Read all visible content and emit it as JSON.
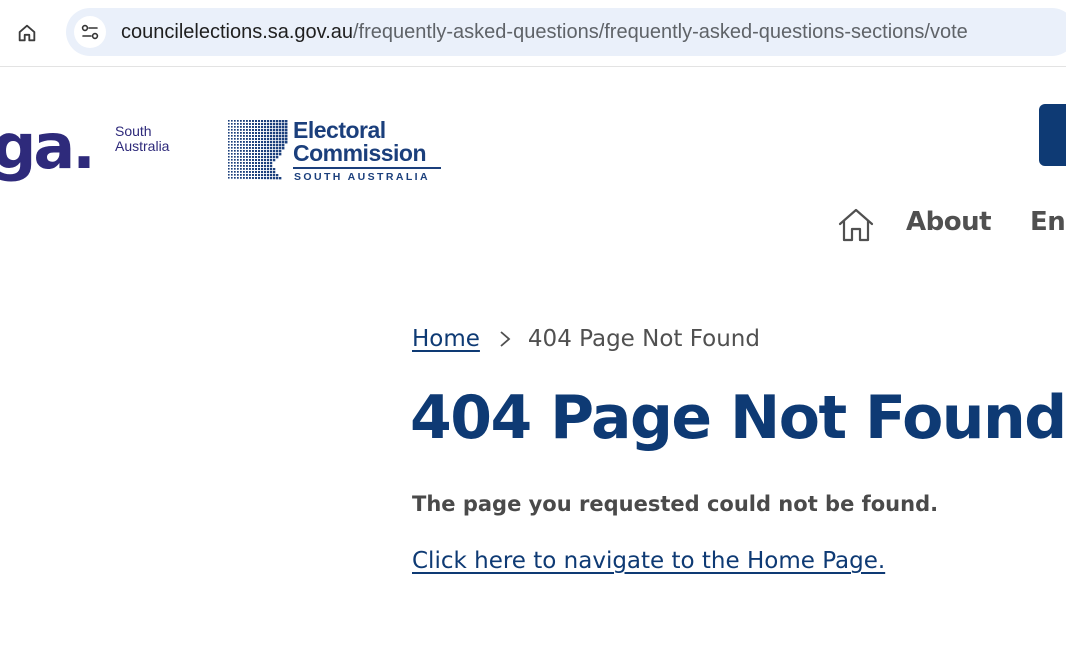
{
  "browser": {
    "url_domain": "councilelections.sa.gov.au",
    "url_path": "/frequently-asked-questions/frequently-asked-questions-sections/vote",
    "home_icon": "home-icon",
    "site_info_icon": "tune-icon"
  },
  "header": {
    "lga_logo": {
      "text": "ga.",
      "region_line1": "South",
      "region_line2": "Australia"
    },
    "ecsa_logo": {
      "line1": "Electoral",
      "line2": "Commission",
      "sub": "SOUTH AUSTRALIA"
    },
    "nav": {
      "home_icon": "home-icon",
      "items": [
        {
          "label": "About"
        },
        {
          "label": "Enr"
        }
      ]
    }
  },
  "breadcrumb": {
    "home_label": "Home",
    "current_label": "404 Page Not Found"
  },
  "main": {
    "title": "404 Page Not Found",
    "message": "The page you requested could not be found.",
    "home_link": "Click here to navigate to the Home Page."
  },
  "colors": {
    "primary": "#0e3a74",
    "lga": "#2e2a7b",
    "text": "#505050",
    "address_bar": "#eaf0fa"
  }
}
